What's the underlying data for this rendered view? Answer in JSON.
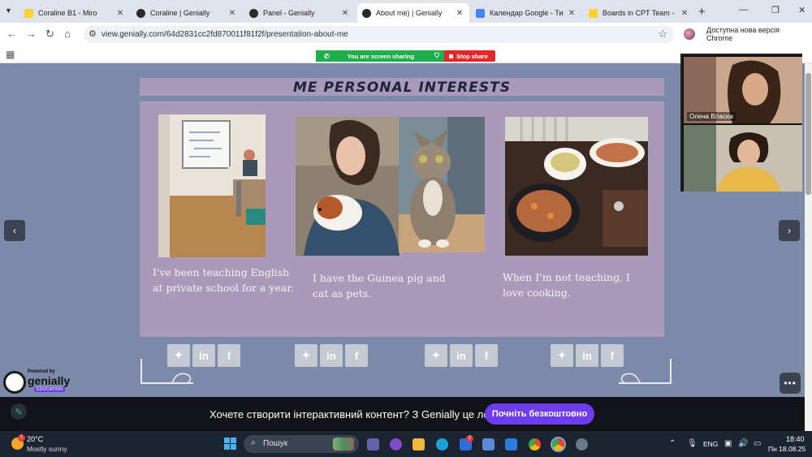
{
  "browser": {
    "tabs": [
      {
        "title": "Coraline B1 - Miro",
        "favicon_color": "#ffd02f",
        "active": false
      },
      {
        "title": "Coraline | Genially",
        "favicon_color": "#2b2b2b",
        "active": false
      },
      {
        "title": "Panel - Genially",
        "favicon_color": "#2b2b2b",
        "active": false
      },
      {
        "title": "About me) | Genially",
        "favicon_color": "#2b2b2b",
        "active": true
      },
      {
        "title": "Календар Google - Тиждень",
        "favicon_color": "#4285f4",
        "active": false
      },
      {
        "title": "Boards in CPT Team - Miro",
        "favicon_color": "#ffd02f",
        "active": false
      }
    ],
    "url": "view.genially.com/64d2831cc2fd870011f81f2f/presentation-about-me",
    "update_label": "Доступна нова версія Chrome",
    "screen_share": {
      "message": "You are screen sharing",
      "stop_label": "Stop share"
    }
  },
  "slide": {
    "title": "ME PERSONAL INTERESTS",
    "captions": [
      "I've been teaching English at private school for a year.",
      "I have the Guinea pig and cat as pets.",
      "When I'm not teaching, I love cooking."
    ]
  },
  "social_groups": [
    [
      "twitter",
      "linkedin",
      "facebook"
    ],
    [
      "twitter",
      "linkedin",
      "facebook"
    ],
    [
      "twitter",
      "linkedin",
      "facebook"
    ],
    [
      "twitter",
      "linkedin",
      "facebook"
    ]
  ],
  "video_call": {
    "participant_1": "Олена Власюк"
  },
  "genially": {
    "powered_by": "Powered by",
    "brand": "genially",
    "tag": "EDUCATION"
  },
  "promo": {
    "text": "Хочете створити інтерактивний контент? З Genially це легко!",
    "button": "Почніть безкоштовно"
  },
  "taskbar": {
    "weather_temp": "20°C",
    "weather_desc": "Mostly sunny",
    "weather_badge": "1",
    "search_label": "Пошук",
    "app_badge": "2",
    "lang": "ENG",
    "time": "18:40",
    "date": "Пн 18.08.25"
  },
  "colors": {
    "accent": "#6e3cf0",
    "slide_bg": "#7a8aa8",
    "card": "#a89ab8",
    "share_green": "#1fae4b",
    "stop_red": "#e02a2a"
  }
}
